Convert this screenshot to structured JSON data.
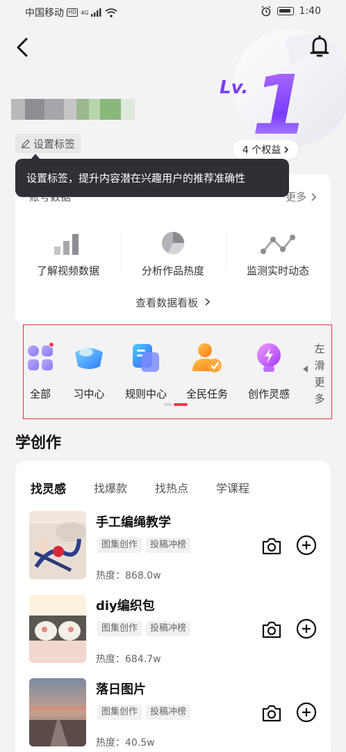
{
  "status_bar": {
    "carrier": "中国移动",
    "hd": "HD",
    "net": "4G",
    "time": "1:40"
  },
  "header": {
    "level_prefix": "Lv.",
    "level_number": "1",
    "tag_button": "设置标签",
    "benefits_button": "4 个权益"
  },
  "tooltip": {
    "text": "设置标签，提升内容潜在兴趣用户的推荐准确性"
  },
  "account_card": {
    "title": "账号数据",
    "more": "更多",
    "metrics": [
      {
        "label": "了解视频数据",
        "icon": "bar-chart-icon"
      },
      {
        "label": "分析作品热度",
        "icon": "pie-chart-icon"
      },
      {
        "label": "监测实时动态",
        "icon": "line-trend-icon"
      }
    ],
    "dashboard_link": "查看数据看板"
  },
  "tools": {
    "items": [
      {
        "label": "全部",
        "icon": "grid-icon",
        "badge": true
      },
      {
        "label": "习中心",
        "icon": "learning-icon"
      },
      {
        "label": "规则中心",
        "icon": "rules-icon"
      },
      {
        "label": "全民任务",
        "icon": "task-icon"
      },
      {
        "label": "创作灵感",
        "icon": "inspiration-icon"
      }
    ],
    "slide_hint": "左滑更多",
    "highlight_color": "#e8303a"
  },
  "learn": {
    "section_title": "学创作",
    "tabs": [
      "找灵感",
      "找爆款",
      "找热点",
      "学课程"
    ],
    "items": [
      {
        "title": "手工编绳教学",
        "tags": [
          "图集创作",
          "投稿冲榜"
        ],
        "heat_label": "热度：",
        "heat_value": "868.0w"
      },
      {
        "title": "diy编织包",
        "tags": [
          "图集创作",
          "投稿冲榜"
        ],
        "heat_label": "热度：",
        "heat_value": "684.7w"
      },
      {
        "title": "落日图片",
        "tags": [
          "图集创作",
          "投稿冲榜"
        ],
        "heat_label": "热度：",
        "heat_value": "40.5w"
      }
    ]
  }
}
